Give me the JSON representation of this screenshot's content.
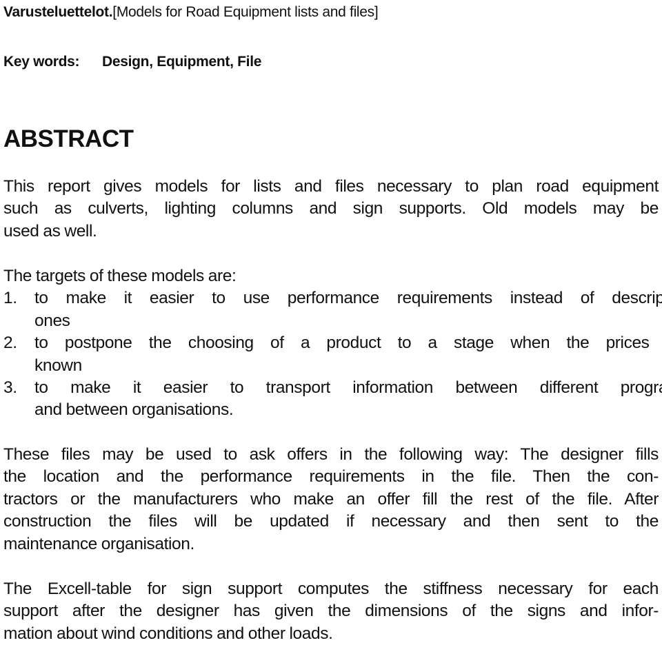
{
  "header": {
    "title_bold": "Varusteluettelot.",
    "title_rest": "[Models for Road Equipment lists and files]",
    "keywords_label": "Key words:",
    "keywords_value": "Design, Equipment, File"
  },
  "abstract": {
    "heading": "ABSTRACT",
    "paragraph1_lines": [
      "This report gives models for lists and files necessary to plan road equipment",
      "such as culverts, lighting columns and sign supports. Old models may be",
      "used as well."
    ],
    "targets_intro": "The targets of these models are:",
    "targets": [
      {
        "number": "1.",
        "lines": [
          "to make it easier to use performance requirements instead of descriptive",
          "ones"
        ]
      },
      {
        "number": "2.",
        "lines": [
          "to postpone the choosing of a product to a stage when the prices are",
          "known"
        ]
      },
      {
        "number": "3.",
        "lines": [
          "to make it easier to transport information between different programs",
          "and between organisations."
        ]
      }
    ],
    "paragraph3_lines": [
      "These files may be used to ask offers in the following way: The designer fills",
      "the location and the performance requirements in the file. Then the con-",
      "tractors or the manufacturers who make an offer fill the rest of the file. After",
      "construction the files will be updated if necessary and then sent to the",
      "maintenance organisation."
    ],
    "paragraph4_lines": [
      "The Excell-table for sign support computes the stiffness necessary for each",
      "support after the designer has given the dimensions of the signs and infor-",
      "mation about wind conditions and other loads."
    ]
  }
}
